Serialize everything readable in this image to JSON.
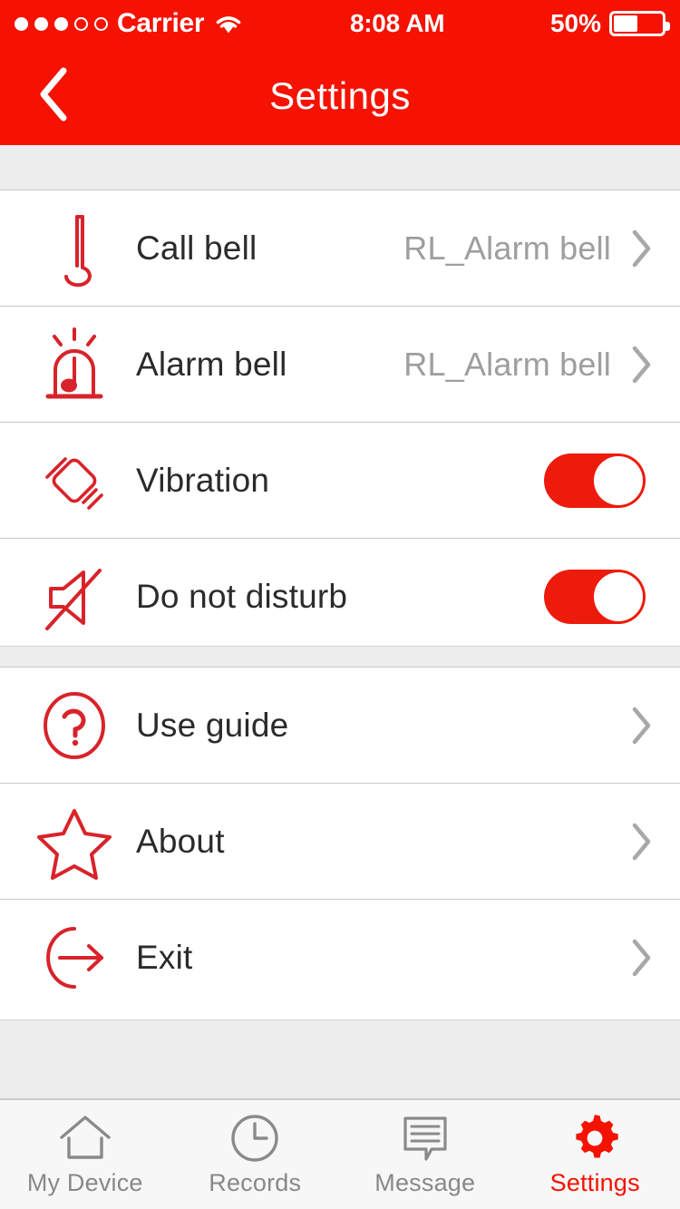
{
  "status_bar": {
    "carrier": "Carrier",
    "signal_dots_filled": 3,
    "signal_dots_total": 5,
    "wifi_icon": "wifi-icon",
    "time": "8:08 AM",
    "battery_percent": "50%",
    "battery_level": 50
  },
  "nav": {
    "back_icon": "chevron-left-icon",
    "title": "Settings"
  },
  "colors": {
    "brand_red": "#F51200",
    "toggle_on": "#ED1B0C",
    "row_value_gray": "#9e9e9e",
    "group_gap": "#EDEDED",
    "tabbar_bg": "#F7F7F7",
    "tab_inactive": "#888888"
  },
  "groups": [
    {
      "rows": [
        {
          "icon": "music-note-icon",
          "label": "Call bell",
          "value": "RL_Alarm bell",
          "accessory": "chevron-right-icon"
        },
        {
          "icon": "siren-bell-icon",
          "label": "Alarm bell",
          "value": "RL_Alarm bell",
          "accessory": "chevron-right-icon"
        },
        {
          "icon": "vibration-icon",
          "label": "Vibration",
          "accessory": "toggle",
          "toggle_on": true
        },
        {
          "icon": "mute-speaker-icon",
          "label": "Do not disturb",
          "accessory": "toggle",
          "toggle_on": true
        }
      ]
    },
    {
      "rows": [
        {
          "icon": "question-circle-icon",
          "label": "Use guide",
          "accessory": "chevron-right-icon"
        },
        {
          "icon": "star-icon",
          "label": "About",
          "accessory": "chevron-right-icon"
        },
        {
          "icon": "exit-icon",
          "label": "Exit",
          "accessory": "chevron-right-icon"
        }
      ]
    }
  ],
  "tabs": [
    {
      "icon": "home-icon",
      "label": "My Device",
      "active": false
    },
    {
      "icon": "clock-icon",
      "label": "Records",
      "active": false
    },
    {
      "icon": "message-icon",
      "label": "Message",
      "active": false
    },
    {
      "icon": "gear-icon",
      "label": "Settings",
      "active": true
    }
  ]
}
